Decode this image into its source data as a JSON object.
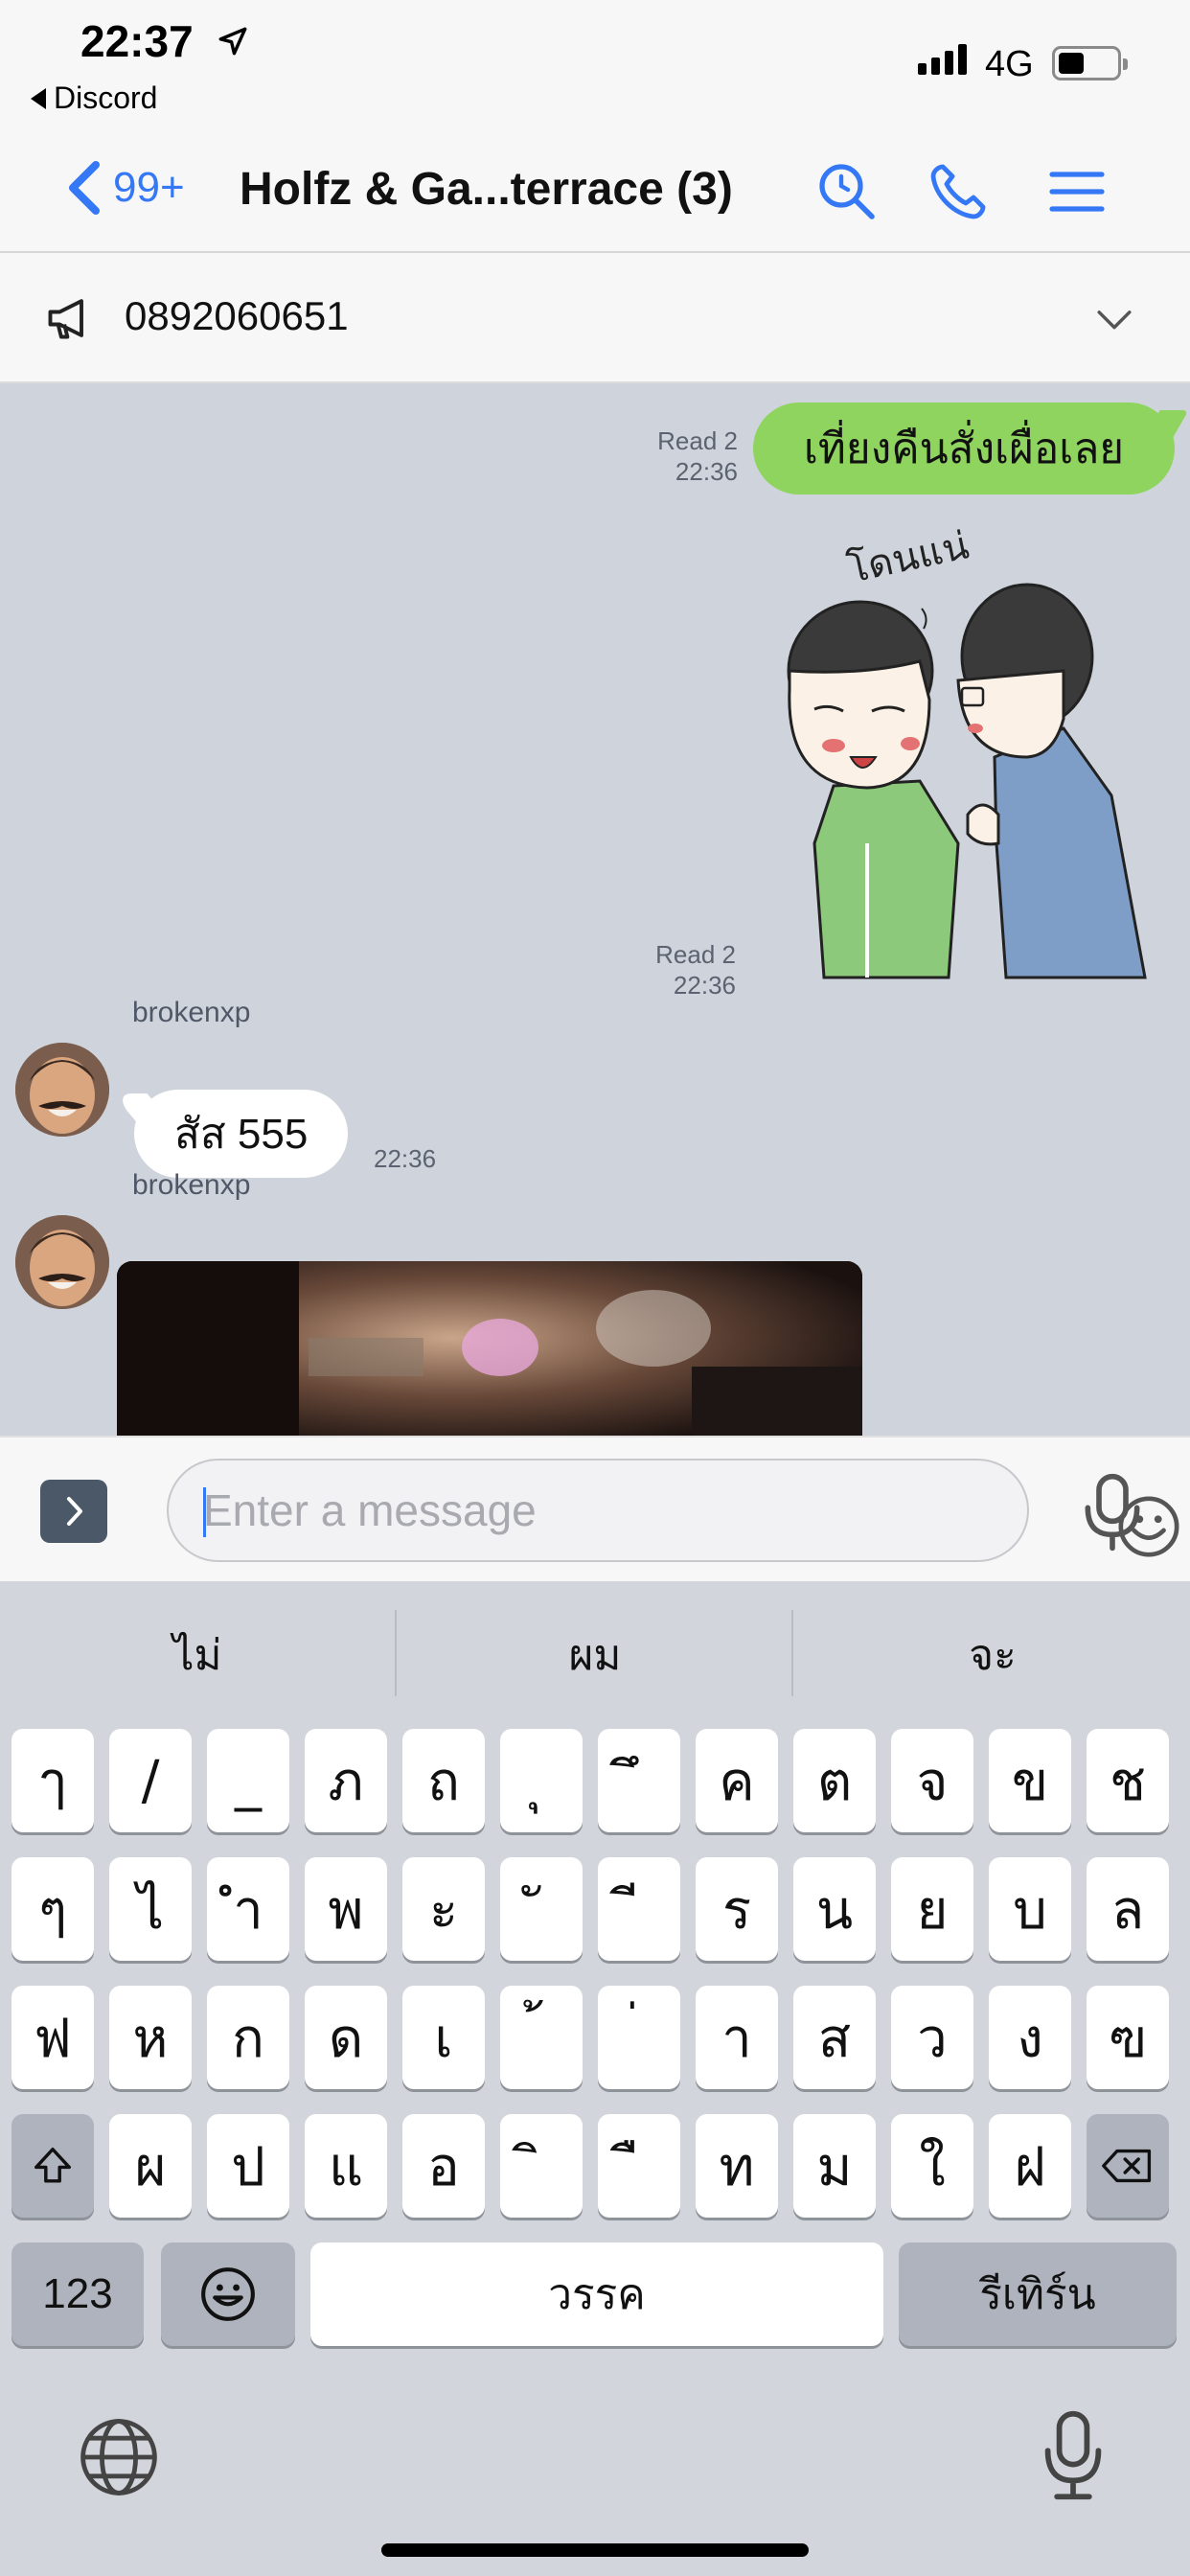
{
  "status_bar": {
    "time": "22:37",
    "back_app": "Discord",
    "network": "4G",
    "battery_level": 0.4
  },
  "header": {
    "unread_count": "99+",
    "title": "Holfz & Ga...terrace (3)"
  },
  "announcement": {
    "text": "0892060651"
  },
  "messages": {
    "outgoing_text": {
      "text": "เที่ยงคืนสั่งเผื่อเลย",
      "read": "Read 2",
      "time": "22:36"
    },
    "outgoing_sticker": {
      "read": "Read 2",
      "time": "22:36",
      "caption": "โดนแน่"
    },
    "incoming_text": {
      "sender": "brokenxp",
      "text": "สัส 555",
      "time": "22:36"
    },
    "incoming_media": {
      "sender": "brokenxp"
    }
  },
  "composer": {
    "placeholder": "Enter a message"
  },
  "keyboard": {
    "suggestions": [
      "ไม่",
      "ผม",
      "จะ"
    ],
    "row1": [
      "ๅ",
      "/",
      "_",
      "ภ",
      "ถ",
      "ุ",
      "ึ",
      "ค",
      "ต",
      "จ",
      "ข",
      "ช"
    ],
    "row2": [
      "ๆ",
      "ไ",
      "ำ",
      "พ",
      "ะ",
      "ั",
      "ี",
      "ร",
      "น",
      "ย",
      "บ",
      "ล"
    ],
    "row3": [
      "ฟ",
      "ห",
      "ก",
      "ด",
      "เ",
      "้",
      "่",
      "า",
      "ส",
      "ว",
      "ง",
      "ฃ"
    ],
    "row4": [
      "ผ",
      "ป",
      "แ",
      "อ",
      "ิ",
      "ื",
      "ท",
      "ม",
      "ใ",
      "ฝ"
    ],
    "numbers_label": "123",
    "space_label": "วรรค",
    "return_label": "รีเทิร์น"
  }
}
